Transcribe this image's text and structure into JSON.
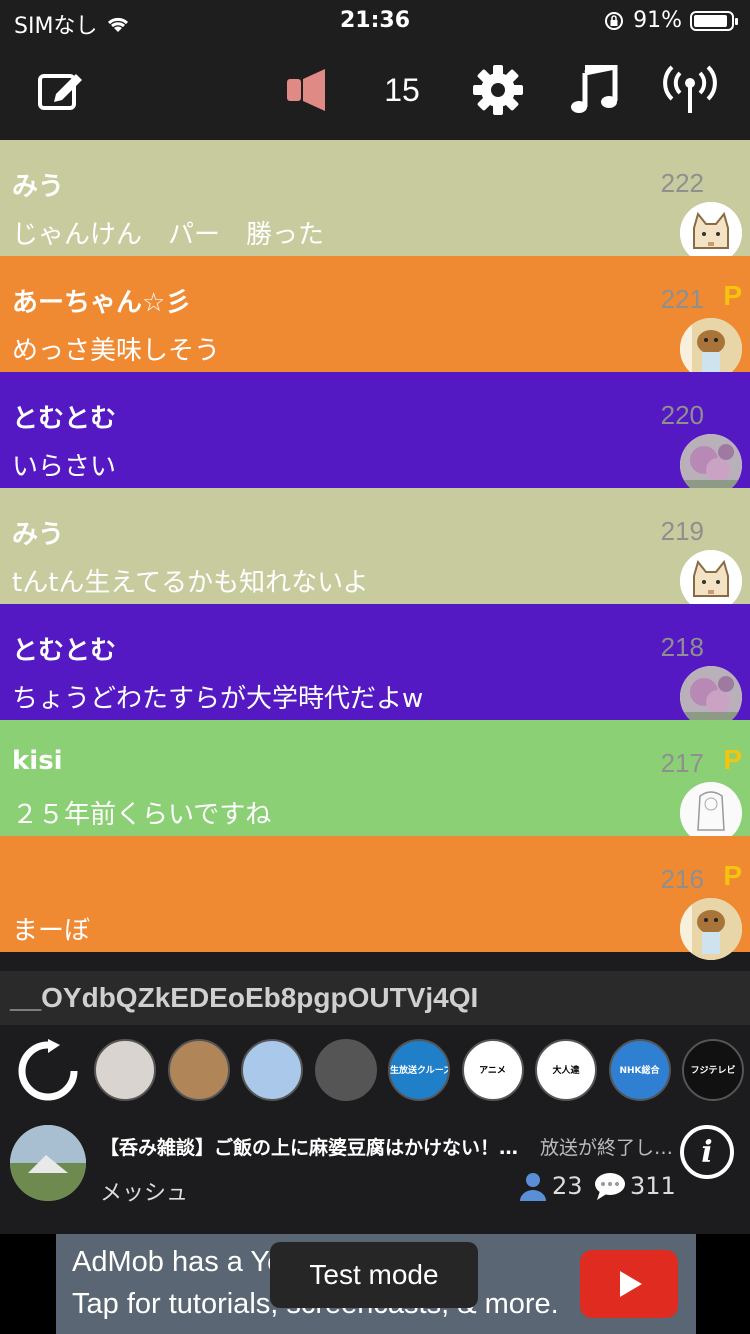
{
  "status": {
    "carrier": "SIMなし",
    "time": "21:36",
    "battery_text": "91%",
    "battery_level": 0.91
  },
  "toolbar": {
    "volume_count": "15",
    "icons": [
      "compose-icon",
      "speaker-icon",
      "gear-icon",
      "music-note-icon",
      "broadcast-icon"
    ]
  },
  "comments": [
    {
      "name": "みう",
      "text": "じゃんけん　パー　勝った",
      "num": "222",
      "premium": false,
      "bg": "#c8cb9d",
      "avatar": "cat-avatar"
    },
    {
      "name": "あーちゃん☆彡",
      "text": "めっさ美味しそう",
      "num": "221",
      "premium": true,
      "badge": "P",
      "bg": "#ef8a33",
      "avatar": "chipmunk-avatar"
    },
    {
      "name": "とむとむ",
      "text": "いらさい",
      "num": "220",
      "premium": false,
      "bg": "#5419c2",
      "avatar": "flower-avatar"
    },
    {
      "name": "みう",
      "text": "tんtん生えてるかも知れないよ",
      "num": "219",
      "premium": false,
      "bg": "#c8cb9d",
      "avatar": "cat-avatar"
    },
    {
      "name": "とむとむ",
      "text": "ちょうどわたすらが大学時代だよw",
      "num": "218",
      "premium": false,
      "bg": "#5419c2",
      "avatar": "flower-avatar"
    },
    {
      "name": "kisi",
      "text": "２５年前くらいですね",
      "num": "217",
      "premium": true,
      "badge": "P",
      "bg": "#8cd075",
      "avatar": "sketch-avatar"
    },
    {
      "name": "",
      "text": "まーぼ",
      "num": "216",
      "premium": true,
      "badge": "P",
      "bg": "#ef8a33",
      "avatar": "chipmunk-avatar"
    }
  ],
  "channel_id": "__OYdbQZkEDEoEb8pgpOUTVj4QI",
  "channels": [
    {
      "name": "channel-mask-icon",
      "bg": "#d9d4d0"
    },
    {
      "name": "channel-woman-icon",
      "bg": "#b08658"
    },
    {
      "name": "channel-anime-icon",
      "bg": "#a9c8ea"
    },
    {
      "name": "channel-masked-girl-icon",
      "bg": "#555"
    },
    {
      "name": "channel-cruise-icon",
      "bg": "#1f7fc8",
      "label": "生放送クルーズ"
    },
    {
      "name": "channel-n-anime-icon",
      "bg": "#ffffff",
      "label": "アニメ"
    },
    {
      "name": "channel-otona-icon",
      "bg": "#ffffff",
      "label": "大人達"
    },
    {
      "name": "channel-nhk-icon",
      "bg": "#2f7fd3",
      "label": "NHK総合"
    },
    {
      "name": "channel-fuji-icon",
      "bg": "#111111",
      "label": "フジテレビ"
    }
  ],
  "stream": {
    "title": "【呑み雑談】ご飯の上に麻婆豆腐はかけない！(…",
    "status": "放送が終了し…",
    "owner": "メッシュ",
    "viewers": "23",
    "comments": "311"
  },
  "ad": {
    "line1": "AdMob has a Yo",
    "line2": "Tap for tutorials, screencasts, & more.",
    "toast": "Test mode"
  }
}
